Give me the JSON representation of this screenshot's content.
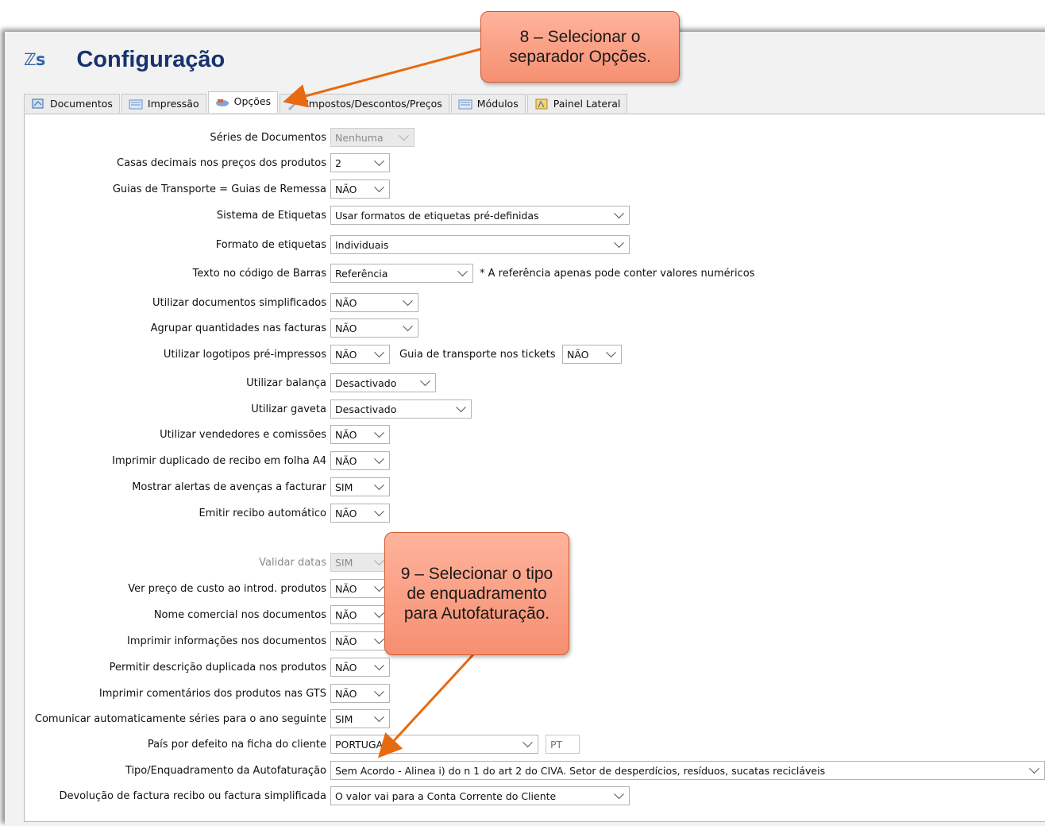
{
  "app": {
    "logo_text": "ℤs",
    "title": "Configuração"
  },
  "tabs": [
    {
      "label": "Documentos",
      "icon": "documents-icon"
    },
    {
      "label": "Impressão",
      "icon": "print-icon"
    },
    {
      "label": "Opções",
      "icon": "options-icon",
      "active": true
    },
    {
      "label": "Impostos/Descontos/Preços",
      "icon": "taxes-icon"
    },
    {
      "label": "Módulos",
      "icon": "modules-icon"
    },
    {
      "label": "Painel Lateral",
      "icon": "side-panel-icon"
    }
  ],
  "settings": [
    {
      "label": "Séries de Documentos",
      "value": "Nenhuma",
      "disabled": true
    },
    {
      "label": "Casas decimais nos preços dos produtos",
      "value": "2"
    },
    {
      "label": "Guias de Transporte = Guias de Remessa",
      "value": "NÃO"
    },
    {
      "label": "Sistema de Etiquetas",
      "value": "Usar formatos de etiquetas pré-definidas"
    },
    {
      "label": "Formato de etiquetas",
      "value": "Individuais"
    },
    {
      "label": "Texto no código de Barras",
      "value": "Referência",
      "note": "* A referência apenas pode conter valores numéricos"
    },
    {
      "label": "Utilizar documentos simplificados",
      "value": "NÃO"
    },
    {
      "label": "Agrupar quantidades nas facturas",
      "value": "NÃO"
    },
    {
      "label": "Utilizar logotipos pré-impressos",
      "value": "NÃO",
      "extra_label": "Guia de transporte nos tickets",
      "extra_value": "NÃO"
    },
    {
      "label": "Utilizar balança",
      "value": "Desactivado"
    },
    {
      "label": "Utilizar gaveta",
      "value": "Desactivado"
    },
    {
      "label": "Utilizar vendedores e comissões",
      "value": "NÃO"
    },
    {
      "label": "Imprimir duplicado de recibo em folha A4",
      "value": "NÃO"
    },
    {
      "label": "Mostrar alertas de avenças a facturar",
      "value": "SIM"
    },
    {
      "label": "Emitir recibo automático",
      "value": "NÃO"
    },
    {
      "label": "Validar datas",
      "value": "SIM",
      "disabled": true
    },
    {
      "label": "Ver preço de custo ao introd. produtos",
      "value": "NÃO"
    },
    {
      "label": "Nome comercial nos documentos",
      "value": "NÃO"
    },
    {
      "label": "Imprimir informações nos documentos",
      "value": "NÃO"
    },
    {
      "label": "Permitir descrição duplicada nos produtos",
      "value": "NÃO"
    },
    {
      "label": "Imprimir comentários dos produtos nas GTS",
      "value": "NÃO"
    },
    {
      "label": "Comunicar automaticamente séries para o ano seguinte",
      "value": "SIM"
    },
    {
      "label": "País por defeito na ficha do cliente",
      "value": "PORTUGAL",
      "country_code": "PT"
    },
    {
      "label": "Tipo/Enquadramento da Autofaturação",
      "value": "Sem Acordo - Alinea i) do n 1 do art 2 do CIVA. Setor de desperdícios, resíduos, sucatas recicláveis"
    },
    {
      "label": "Devolução de factura recibo ou factura simplificada",
      "value": "O valor vai para a Conta Corrente do Cliente"
    }
  ],
  "callouts": [
    {
      "text": "8 – Selecionar o separador Opções."
    },
    {
      "text": "9 – Selecionar o tipo de enquadramento para Autofaturação."
    }
  ],
  "colors": {
    "callout_fill": "#f79b80",
    "arrow": "#e8690f",
    "title": "#17326f"
  }
}
